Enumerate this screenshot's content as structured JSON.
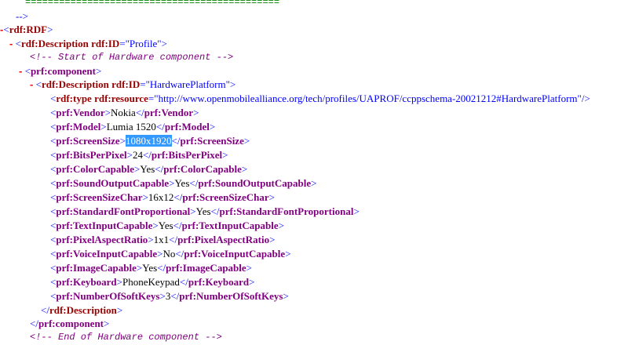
{
  "comment_top": "=============================================",
  "comment_close": "-->",
  "toggle": "-",
  "rdf_open": "rdf:RDF",
  "desc_open_tag": "rdf:Description",
  "rdf_id_attr": "rdf:ID",
  "rdf_id_profile": "Profile",
  "comment_start": "<!--  Start of Hardware component -->",
  "component_tag": "prf:component",
  "rdf_id_hw": "HardwarePlatform",
  "type_tag": "rdf:type",
  "resource_attr": "rdf:resource",
  "resource_value": "http://www.openmobilealliance.org/tech/profiles/UAPROF/ccppschema-20021212#HardwarePlatform",
  "props": [
    {
      "name": "prf:Vendor",
      "value": "Nokia"
    },
    {
      "name": "prf:Model",
      "value": "Lumia 1520"
    },
    {
      "name": "prf:ScreenSize",
      "value": "1080x1920"
    },
    {
      "name": "prf:BitsPerPixel",
      "value": "24"
    },
    {
      "name": "prf:ColorCapable",
      "value": "Yes"
    },
    {
      "name": "prf:SoundOutputCapable",
      "value": "Yes"
    },
    {
      "name": "prf:ScreenSizeChar",
      "value": "16x12"
    },
    {
      "name": "prf:StandardFontProportional",
      "value": "Yes"
    },
    {
      "name": "prf:TextInputCapable",
      "value": "Yes"
    },
    {
      "name": "prf:PixelAspectRatio",
      "value": "1x1"
    },
    {
      "name": "prf:VoiceInputCapable",
      "value": "No"
    },
    {
      "name": "prf:ImageCapable",
      "value": "Yes"
    },
    {
      "name": "prf:Keyboard",
      "value": "PhoneKeypad"
    },
    {
      "name": "prf:NumberOfSoftKeys",
      "value": "3"
    }
  ],
  "desc_close": "rdf:Description",
  "component_close": "prf:component",
  "comment_end": "<!-- End of Hardware component -->"
}
